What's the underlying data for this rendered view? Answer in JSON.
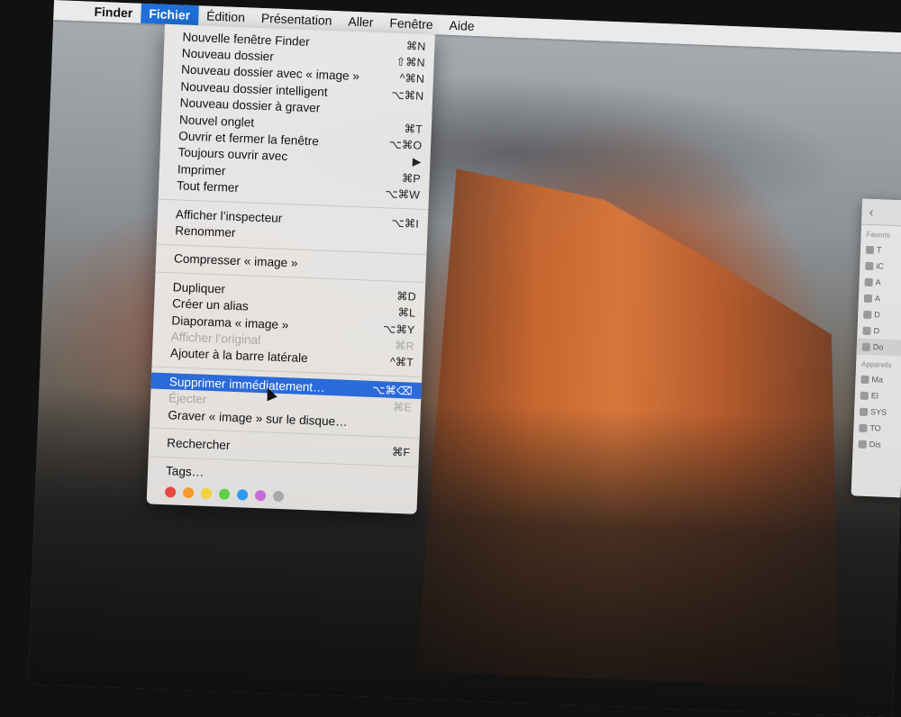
{
  "menubar": {
    "apple_icon": "apple-logo-icon",
    "app_name": "Finder",
    "menus": [
      "Fichier",
      "Édition",
      "Présentation",
      "Aller",
      "Fenêtre",
      "Aide"
    ]
  },
  "file_menu": {
    "groups": [
      [
        {
          "label": "Nouvelle fenêtre Finder",
          "shortcut": "⌘N"
        },
        {
          "label": "Nouveau dossier",
          "shortcut": "⇧⌘N"
        },
        {
          "label": "Nouveau dossier avec « image »",
          "shortcut": "^⌘N"
        },
        {
          "label": "Nouveau dossier intelligent",
          "shortcut": "⌥⌘N"
        },
        {
          "label": "Nouveau dossier à graver",
          "shortcut": ""
        },
        {
          "label": "Nouvel onglet",
          "shortcut": "⌘T"
        },
        {
          "label": "Ouvrir et fermer la fenêtre",
          "shortcut": "⌥⌘O"
        },
        {
          "label": "Toujours ouvrir avec",
          "shortcut": "▶"
        },
        {
          "label": "Imprimer",
          "shortcut": "⌘P"
        },
        {
          "label": "Tout fermer",
          "shortcut": "⌥⌘W"
        }
      ],
      [
        {
          "label": "Afficher l’inspecteur",
          "shortcut": "⌥⌘I"
        },
        {
          "label": "Renommer",
          "shortcut": ""
        }
      ],
      [
        {
          "label": "Compresser « image »",
          "shortcut": ""
        }
      ],
      [
        {
          "label": "Dupliquer",
          "shortcut": "⌘D"
        },
        {
          "label": "Créer un alias",
          "shortcut": "⌘L"
        },
        {
          "label": "Diaporama « image »",
          "shortcut": "⌥⌘Y"
        },
        {
          "label": "Afficher l’original",
          "shortcut": "⌘R",
          "disabled": true
        },
        {
          "label": "Ajouter à la barre latérale",
          "shortcut": "^⌘T"
        }
      ],
      [
        {
          "label": "Supprimer immédiatement…",
          "shortcut": "⌥⌘⌫",
          "highlighted": true
        },
        {
          "label": "Éjecter",
          "shortcut": "⌘E",
          "disabled": true
        },
        {
          "label": "Graver « image » sur le disque…",
          "shortcut": ""
        }
      ],
      [
        {
          "label": "Rechercher",
          "shortcut": "⌘F"
        }
      ],
      [
        {
          "label": "Tags…",
          "shortcut": ""
        }
      ]
    ],
    "tag_colors": [
      "#e8483f",
      "#f39a2e",
      "#f3d23a",
      "#5fcf4a",
      "#2d9bf0",
      "#c36ad8",
      "#a8a8a8"
    ]
  },
  "finder_window": {
    "back_icon": "‹",
    "favorites_label": "Favoris",
    "devices_label": "Appareils",
    "favorites": [
      "T",
      "iC",
      "A",
      "A",
      "D",
      "D",
      "Do"
    ],
    "devices": [
      "Ma",
      "El",
      "SYS",
      "TO",
      "Dis"
    ]
  }
}
